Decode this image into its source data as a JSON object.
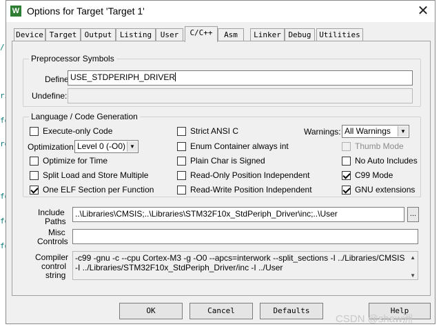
{
  "window": {
    "title": "Options for Target 'Target 1'",
    "app_icon_letter": "W",
    "close_glyph": "✕"
  },
  "tabs": [
    {
      "label": "Device",
      "active": false
    },
    {
      "label": "Target",
      "active": false
    },
    {
      "label": "Output",
      "active": false
    },
    {
      "label": "Listing",
      "active": false
    },
    {
      "label": "User",
      "active": false
    },
    {
      "label": "C/C++",
      "active": true
    },
    {
      "label": "Asm",
      "active": false
    },
    {
      "label": "Linker",
      "active": false
    },
    {
      "label": "Debug",
      "active": false
    },
    {
      "label": "Utilities",
      "active": false
    }
  ],
  "preprocessor": {
    "title": "Preprocessor Symbols",
    "define_label": "Define:",
    "define_value": "USE_STDPERIPH_DRIVER",
    "undefine_label": "Undefine:",
    "undefine_value": ""
  },
  "language": {
    "title": "Language / Code Generation",
    "execute_only": {
      "label": "Execute-only Code",
      "checked": false
    },
    "optimization_label": "Optimization:",
    "optimization_value": "Level 0 (-O0)",
    "optimize_time": {
      "label": "Optimize for Time",
      "checked": false
    },
    "split_load": {
      "label": "Split Load and Store Multiple",
      "checked": false
    },
    "one_elf": {
      "label": "One ELF Section per Function",
      "checked": true
    },
    "strict_ansi": {
      "label": "Strict ANSI C",
      "checked": false
    },
    "enum_container": {
      "label": "Enum Container always int",
      "checked": false
    },
    "plain_char": {
      "label": "Plain Char is Signed",
      "checked": false
    },
    "ro_pi": {
      "label": "Read-Only Position Independent",
      "checked": false
    },
    "rw_pi": {
      "label": "Read-Write Position Independent",
      "checked": false
    },
    "warnings_label": "Warnings:",
    "warnings_value": "All Warnings",
    "thumb_mode": {
      "label": "Thumb Mode",
      "checked": false,
      "disabled": true
    },
    "no_auto_includes": {
      "label": "No Auto Includes",
      "checked": false
    },
    "c99_mode": {
      "label": "C99 Mode",
      "checked": true
    },
    "gnu_extensions": {
      "label": "GNU extensions",
      "checked": true
    }
  },
  "include": {
    "label_line1": "Include",
    "label_line2": "Paths",
    "value": "..\\Libraries\\CMSIS;..\\Libraries\\STM32F10x_StdPeriph_Driver\\inc;..\\User",
    "browse_label": "..."
  },
  "misc": {
    "label_line1": "Misc",
    "label_line2": "Controls",
    "value": ""
  },
  "compiler": {
    "label_line1": "Compiler",
    "label_line2": "control",
    "label_line3": "string",
    "value": "-c99 -gnu -c --cpu Cortex-M3 -g -O0 --apcs=interwork --split_sections -I ../Libraries/CMSIS -I ../Libraries/STM32F10x_StdPeriph_Driver/inc -I ../User"
  },
  "buttons": {
    "ok": "OK",
    "cancel": "Cancel",
    "defaults": "Defaults",
    "help": "Help"
  },
  "watermark": "CSDN @shaw洲",
  "edge_marks": [
    "/",
    "ri",
    "fe",
    "re",
    "fo",
    "fo",
    "fo"
  ]
}
